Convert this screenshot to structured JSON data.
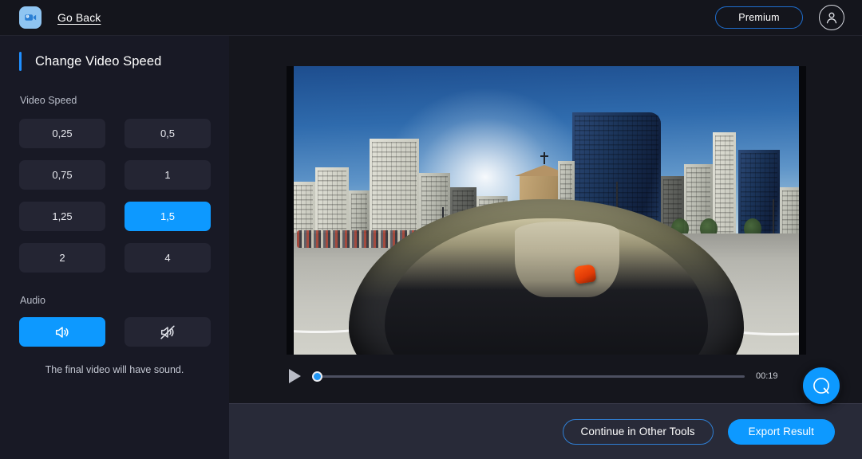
{
  "header": {
    "logo_icon": "video-camera-logo-icon",
    "go_back_label": "Go Back",
    "premium_label": "Premium",
    "avatar_icon": "user-avatar-icon"
  },
  "sidebar": {
    "panel_title": "Change Video Speed",
    "speed_section_label": "Video Speed",
    "speed_options": [
      {
        "label": "0,25",
        "selected": false
      },
      {
        "label": "0,5",
        "selected": false
      },
      {
        "label": "0,75",
        "selected": false
      },
      {
        "label": "1",
        "selected": false
      },
      {
        "label": "1,25",
        "selected": false
      },
      {
        "label": "1,5",
        "selected": true
      },
      {
        "label": "2",
        "selected": false
      },
      {
        "label": "4",
        "selected": false
      }
    ],
    "audio_section_label": "Audio",
    "audio_options": [
      {
        "icon": "speaker-on-icon",
        "selected": true
      },
      {
        "icon": "speaker-muted-icon",
        "selected": false
      }
    ],
    "audio_note": "The final video will have sound."
  },
  "player": {
    "play_icon": "play-icon",
    "current_time": "00:19",
    "progress_percent": 0,
    "video_description": "360-degree panoramic city street view with high-rise buildings, a small church, blue sky and a curved road tunnel with an orange car"
  },
  "footer": {
    "continue_label": "Continue in Other Tools",
    "export_label": "Export Result"
  },
  "help": {
    "icon": "chat-bubble-icon"
  },
  "colors": {
    "accent_blue": "#0d99ff",
    "sidebar_bg": "#181925",
    "main_bg": "#15161d",
    "footer_bg": "#282a38",
    "header_bg": "#14151c",
    "button_bg": "#242533",
    "text_primary": "#ffffff",
    "text_secondary": "#b9bdc9",
    "premium_border": "#1f6fd0"
  }
}
